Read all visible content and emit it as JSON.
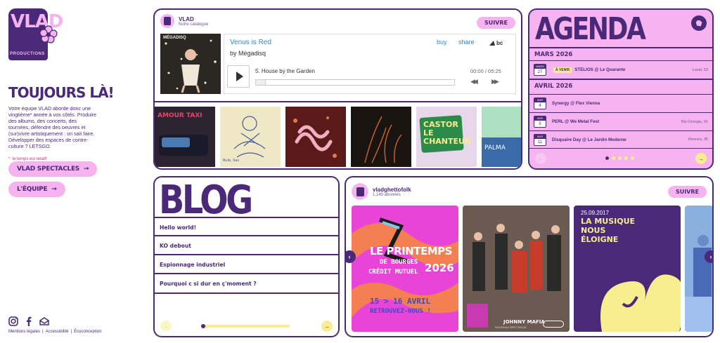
{
  "sidebar": {
    "logo_text": "VLAD",
    "logo_sub": "PRODUCTIONS",
    "tagline": "TOUJOURS LÀ!",
    "intro": "Votre équipe VLAD aborde donc une vingtième* année à vos côtés. Produire des albums, des concerts, des tournées, défendre des oeuvres et (sur)vivre artistiquement : on sait faire. Développer des espaces de contre-culture ? LETSGO.",
    "note": "*: le temps est relatif",
    "btn_spectacles": "VLAD SPECTACLES",
    "btn_equipe": "L'ÉQUIPE",
    "footer": {
      "mentions": "Mentions légales",
      "accessibilite": "Accessibilité",
      "ecoconception": "Écoconception"
    }
  },
  "catalog": {
    "name": "VLAD",
    "sub": "Notre catalogue",
    "follow": "SUIVRE",
    "player": {
      "cover_text": "MÉGADISQ",
      "title": "Venus is Red",
      "artist": "by Mégadisq",
      "buy": "buy",
      "share": "share",
      "bc": "bc",
      "track": "5.   House by the Garden",
      "time": "00:00 / 05:25"
    },
    "albums": [
      {
        "label": "AMOUR TAXI",
        "colors": [
          "#3a2a3a",
          "#e0466a"
        ]
      },
      {
        "label": "Bule, Sas",
        "colors": [
          "#efe8c6",
          "#7a8fb8"
        ]
      },
      {
        "label": "",
        "colors": [
          "#5a1a1a",
          "#e4a0b0"
        ]
      },
      {
        "label": "",
        "colors": [
          "#1a1410",
          "#c8662a"
        ]
      },
      {
        "label": "CASTOR LE CHANTEUR",
        "colors": [
          "#e8d6ea",
          "#2a8b4a"
        ]
      },
      {
        "label": "PALMA",
        "colors": [
          "#aee0c2",
          "#3a6aa8"
        ]
      }
    ]
  },
  "agenda": {
    "title": "AGENDA",
    "months": [
      {
        "name": "MARS 2026",
        "events": [
          {
            "m": "MARS",
            "d": "27",
            "badge": "À VENIR",
            "name": "STELIOS @ Le Quarante",
            "place": "Laval, 53"
          }
        ]
      },
      {
        "name": "AVRIL 2026",
        "events": [
          {
            "m": "AVR",
            "d": "4",
            "badge": "",
            "name": "Synergy @ Flex Vienna",
            "place": ""
          },
          {
            "m": "AVR",
            "d": "5",
            "badge": "",
            "name": "PERL @ We Metal Fest",
            "place": "Ris-Orangis, 91"
          },
          {
            "m": "AVR",
            "d": "11",
            "badge": "",
            "name": "Disquaire Day @ Le Jardin Moderne",
            "place": "Rennes, 35"
          }
        ]
      }
    ]
  },
  "blog": {
    "title": "BLOG",
    "posts": [
      "Hello world!",
      "KO debout",
      "Espionnage industriel",
      "Pourquoi c si dur en ç'moment ?"
    ]
  },
  "instagram": {
    "name": "vladghettofolk",
    "count": "1,149 abonnés",
    "follow": "SUIVRE",
    "posts": [
      {
        "line1": "LE PRINTEMPS",
        "line2": "DE BOURGES",
        "line3": "CRÉDIT MUTUEL",
        "year": "2026",
        "dates": "15 > 16 AVRIL",
        "cta": "RETROUVEZ-NOUS !"
      },
      {
        "band": "JOHNNY MAFIA",
        "sub": "NOUVEAU SPECTACLE"
      },
      {
        "date": "25.09.2017",
        "title": "LA MUSIQUE NOUS ÉLOIGNE"
      },
      {}
    ]
  },
  "colors": {
    "purple": "#4a2a78",
    "pink": "#f7b3f0",
    "yellow": "#f9ee8f"
  }
}
